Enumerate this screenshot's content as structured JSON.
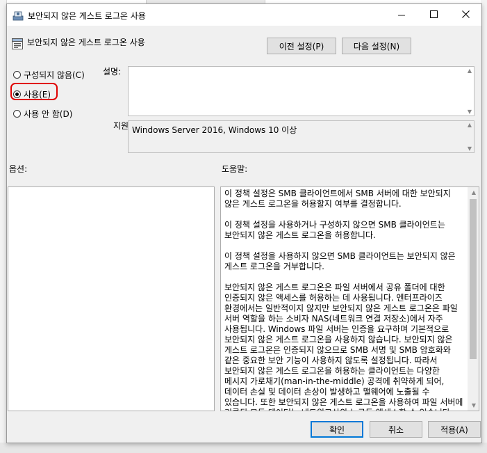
{
  "window": {
    "title": "보안되지 않은 게스트 로그온 사용",
    "minimize_glyph": "—",
    "maximize_glyph": "☐",
    "close_glyph": "✕"
  },
  "header": {
    "policy_name": "보안되지 않은 게스트 로그온 사용",
    "prev_button": "이전 설정(P)",
    "next_button": "다음 설정(N)"
  },
  "state_options": [
    {
      "label": "구성되지 않음(C)",
      "selected": false
    },
    {
      "label": "사용(E)",
      "selected": true
    },
    {
      "label": "사용 안 함(D)",
      "selected": false
    }
  ],
  "comment": {
    "label": "설명:",
    "value": ""
  },
  "supported": {
    "label": "지원:",
    "value": "Windows Server 2016, Windows 10 이상"
  },
  "options_label": "옵션:",
  "help_label": "도움말:",
  "help_text": "이 정책 설정은 SMB 클라이언트에서 SMB 서버에 대한 보안되지 않은 게스트 로그온을 허용할지 여부를 결정합니다.\n\n이 정책 설정을 사용하거나 구성하지 않으면 SMB 클라이언트는 보안되지 않은 게스트 로그온을 허용합니다.\n\n이 정책 설정을 사용하지 않으면 SMB 클라이언트는 보안되지 않은 게스트 로그온을 거부합니다.\n\n보안되지 않은 게스트 로그온은 파일 서버에서 공유 폴더에 대한 인증되지 않은 액세스를 허용하는 데 사용됩니다. 엔터프라이즈 환경에서는 일반적이지 않지만 보안되지 않은 게스트 로그온은 파일 서버 역할을 하는 소비자 NAS(네트워크 연결 저장소)에서 자주 사용됩니다. Windows 파일 서버는 인증을 요구하며 기본적으로 보안되지 않은 게스트 로그온을 사용하지 않습니다. 보안되지 않은 게스트 로그온은 인증되지 않으므로 SMB 서명 및 SMB 암호화와 같은 중요한 보안 기능이 사용하지 않도록 설정됩니다. 따라서 보안되지 않은 게스트 로그온을 허용하는 클라이언트는 다양한 메시지 가로채기(man-in-the-middle) 공격에 취약하게 되어, 데이터 손실 및 데이터 손상이 발생하고 맬웨어에 노출될 수 있습니다. 또한 보안되지 않은 게스트 로그온을 사용하여 파일 서버에 기록된 모든 데이터는 네트워크상의 누구든 액세스할 수 있습니다.",
  "footer": {
    "ok": "확인",
    "cancel": "취소",
    "apply": "적용(A)"
  },
  "colors": {
    "accent": "#0078d7",
    "highlight_ring": "#e00000"
  }
}
